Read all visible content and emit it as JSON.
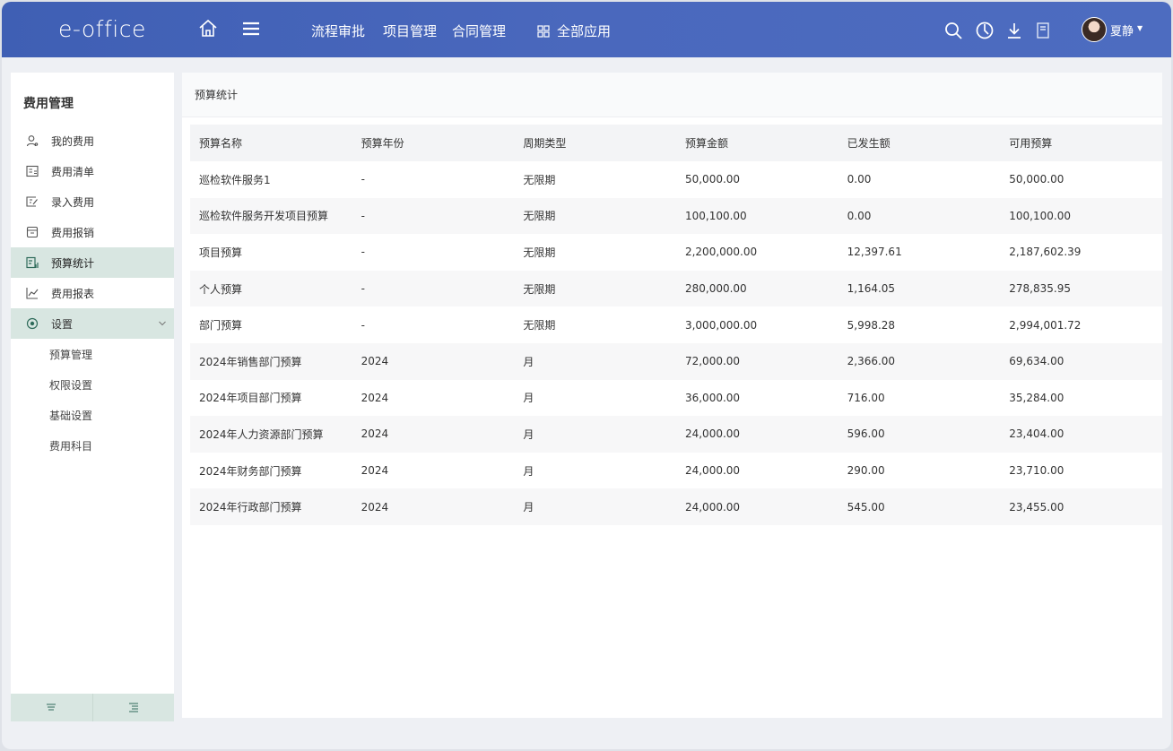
{
  "topbar": {
    "logo": "e-office",
    "nav": [
      "流程审批",
      "项目管理",
      "合同管理"
    ],
    "apps_label": "全部应用",
    "user_name": "夏静",
    "icons": [
      "home-icon",
      "menu-icon",
      "search-icon",
      "clock-icon",
      "download-icon",
      "note-icon"
    ]
  },
  "sidebar": {
    "title": "费用管理",
    "items": [
      {
        "label": "我的费用",
        "icon": "user-icon"
      },
      {
        "label": "费用清单",
        "icon": "list-icon"
      },
      {
        "label": "录入费用",
        "icon": "edit-icon"
      },
      {
        "label": "费用报销",
        "icon": "box-icon"
      },
      {
        "label": "预算统计",
        "icon": "stats-icon",
        "active": true
      },
      {
        "label": "费用报表",
        "icon": "chart-icon"
      },
      {
        "label": "设置",
        "icon": "settings-icon",
        "expanded": true
      }
    ],
    "sub_items": [
      "预算管理",
      "权限设置",
      "基础设置",
      "费用科目"
    ]
  },
  "main": {
    "title": "预算统计",
    "columns": [
      "预算名称",
      "预算年份",
      "周期类型",
      "预算金额",
      "已发生额",
      "可用预算"
    ],
    "rows": [
      [
        "巡检软件服务1",
        "-",
        "无限期",
        "50,000.00",
        "0.00",
        "50,000.00"
      ],
      [
        "巡检软件服务开发项目预算",
        "-",
        "无限期",
        "100,100.00",
        "0.00",
        "100,100.00"
      ],
      [
        "项目预算",
        "-",
        "无限期",
        "2,200,000.00",
        "12,397.61",
        "2,187,602.39"
      ],
      [
        "个人预算",
        "-",
        "无限期",
        "280,000.00",
        "1,164.05",
        "278,835.95"
      ],
      [
        "部门预算",
        "-",
        "无限期",
        "3,000,000.00",
        "5,998.28",
        "2,994,001.72"
      ],
      [
        "2024年销售部门预算",
        "2024",
        "月",
        "72,000.00",
        "2,366.00",
        "69,634.00"
      ],
      [
        "2024年项目部门预算",
        "2024",
        "月",
        "36,000.00",
        "716.00",
        "35,284.00"
      ],
      [
        "2024年人力资源部门预算",
        "2024",
        "月",
        "24,000.00",
        "596.00",
        "23,404.00"
      ],
      [
        "2024年财务部门预算",
        "2024",
        "月",
        "24,000.00",
        "290.00",
        "23,710.00"
      ],
      [
        "2024年行政部门预算",
        "2024",
        "月",
        "24,000.00",
        "545.00",
        "23,455.00"
      ]
    ]
  },
  "colors": {
    "topbar": "#4a68bd",
    "sidebar_active": "#d8e6e1",
    "icon_green": "#2f6b5a"
  }
}
